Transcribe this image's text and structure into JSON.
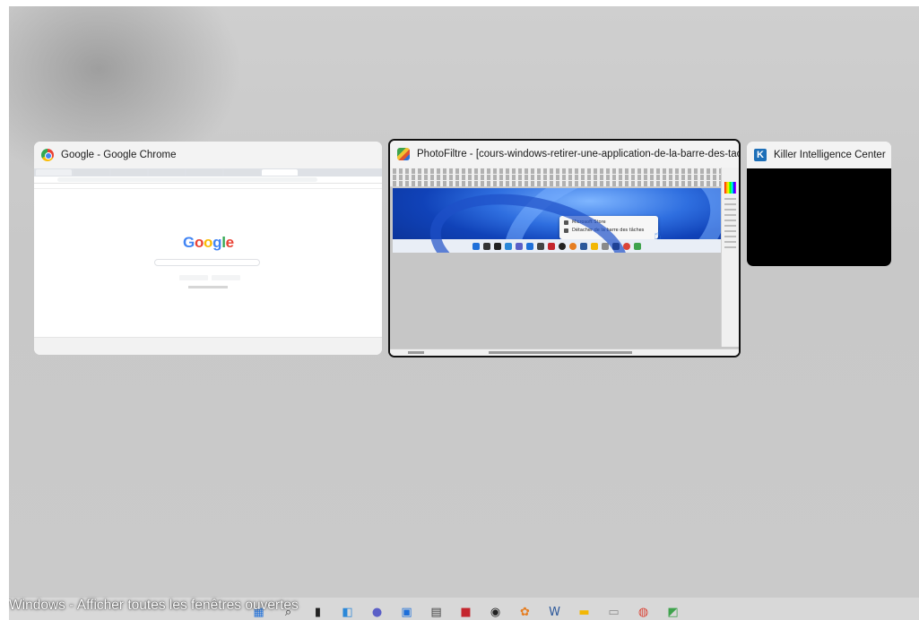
{
  "windows": {
    "chrome": {
      "title": "Google - Google Chrome",
      "icon": "chrome-icon",
      "page_logo": "Google"
    },
    "photofiltre": {
      "title": "PhotoFiltre - [cours-windows-retirer-une-application-de-la-barre-des-taches.jpg]",
      "icon": "photofiltre-icon",
      "context_menu": [
        "Microsoft Store",
        "Détacher de la barre des tâches"
      ]
    },
    "killer": {
      "title": "Killer Intelligence Center",
      "icon": "killer-icon",
      "icon_letter": "K"
    }
  },
  "caption": "Windows - Afficher toutes les fenêtres ouvertes",
  "taskbar": {
    "icons": [
      {
        "name": "start-icon",
        "color": "#1e6fd9"
      },
      {
        "name": "search-icon",
        "color": "#333333"
      },
      {
        "name": "task-view-icon",
        "color": "#222222"
      },
      {
        "name": "widgets-icon",
        "color": "#2b88d8"
      },
      {
        "name": "chat-icon",
        "color": "#5b5fc7"
      },
      {
        "name": "app-icon-1",
        "color": "#1e6fd9"
      },
      {
        "name": "calculator-icon",
        "color": "#444444"
      },
      {
        "name": "app-red-icon",
        "color": "#c4262e"
      },
      {
        "name": "camera-icon",
        "color": "#222222"
      },
      {
        "name": "app-color-wheel-icon",
        "color": "#e67e22"
      },
      {
        "name": "word-icon",
        "color": "#2b579a"
      },
      {
        "name": "file-explorer-icon",
        "color": "#f2b705"
      },
      {
        "name": "app-gray-icon",
        "color": "#8a8a8a"
      },
      {
        "name": "chrome-taskbar-icon",
        "color": "#db4437"
      },
      {
        "name": "photofiltre-taskbar-icon",
        "color": "#3fa34d"
      }
    ]
  },
  "colors": {
    "accent": "#0078d4",
    "google_blue": "#4285f4",
    "google_red": "#ea4335",
    "google_yellow": "#fbbc05",
    "google_green": "#34a853"
  }
}
